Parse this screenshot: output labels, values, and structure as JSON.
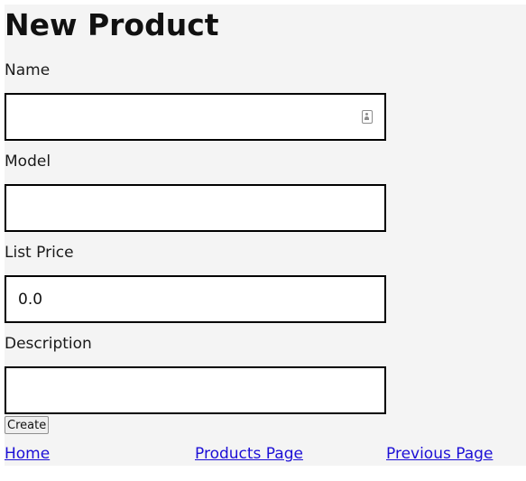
{
  "page": {
    "title": "New Product"
  },
  "form": {
    "name": {
      "label": "Name",
      "value": ""
    },
    "model": {
      "label": "Model",
      "value": ""
    },
    "list_price": {
      "label": "List Price",
      "value": "0.0"
    },
    "description": {
      "label": "Description",
      "value": ""
    },
    "submit_label": "Create"
  },
  "nav": {
    "home": "Home",
    "products": "Products Page",
    "previous": "Previous Page"
  },
  "colors": {
    "page_background": "#f4f4f4",
    "link": "#1c0fd6",
    "input_border": "#000000"
  },
  "icons": {
    "name_field": "contact-card-autofill-icon"
  }
}
